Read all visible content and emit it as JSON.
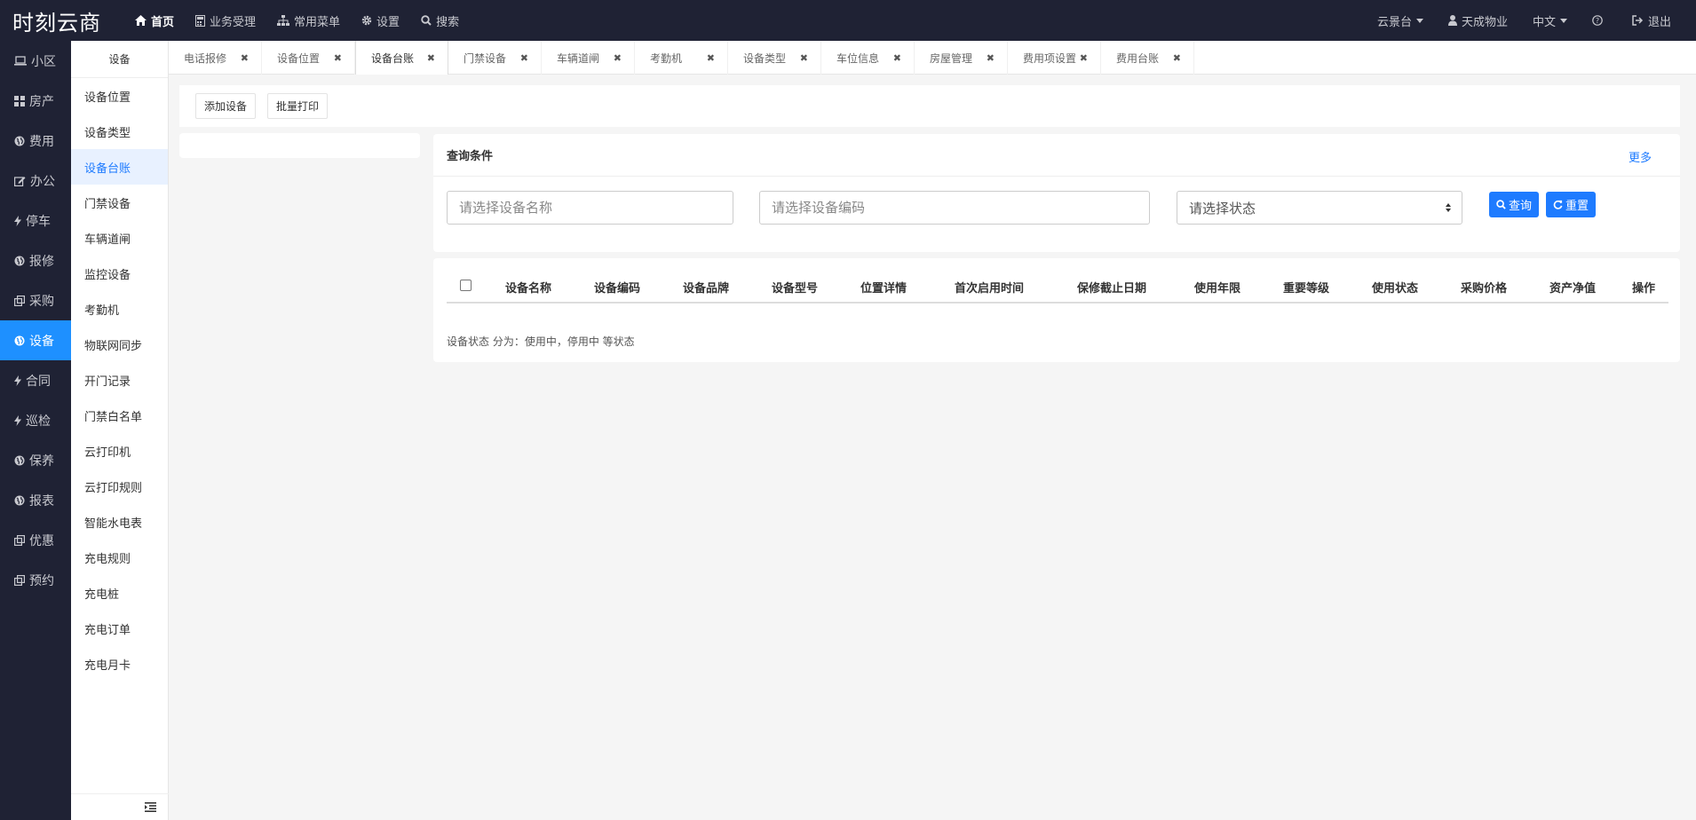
{
  "brand": "时刻云商",
  "topnav": [
    {
      "label": "首页",
      "icon": "home-icon",
      "active": true
    },
    {
      "label": "业务受理",
      "icon": "calculator-icon",
      "active": false
    },
    {
      "label": "常用菜单",
      "icon": "sitemap-icon",
      "active": false
    },
    {
      "label": "设置",
      "icon": "gear-icon",
      "active": false
    },
    {
      "label": "搜索",
      "icon": "search-icon",
      "active": false
    }
  ],
  "topright": {
    "community": "云景台",
    "company": "天成物业",
    "language": "中文",
    "logout": "退出"
  },
  "sidebar": [
    {
      "label": "小区",
      "icon": "laptop-icon"
    },
    {
      "label": "房产",
      "icon": "grid-icon"
    },
    {
      "label": "费用",
      "icon": "globe-icon"
    },
    {
      "label": "办公",
      "icon": "edit-icon"
    },
    {
      "label": "停车",
      "icon": "bolt-icon"
    },
    {
      "label": "报修",
      "icon": "globe-icon"
    },
    {
      "label": "采购",
      "icon": "clone-icon"
    },
    {
      "label": "设备",
      "icon": "globe-icon",
      "active": true
    },
    {
      "label": "合同",
      "icon": "bolt-icon"
    },
    {
      "label": "巡检",
      "icon": "bolt-icon"
    },
    {
      "label": "保养",
      "icon": "globe-icon"
    },
    {
      "label": "报表",
      "icon": "globe-icon"
    },
    {
      "label": "优惠",
      "icon": "clone-icon"
    },
    {
      "label": "预约",
      "icon": "clone-icon"
    }
  ],
  "submenu": {
    "title": "设备",
    "items": [
      {
        "label": "设备位置"
      },
      {
        "label": "设备类型"
      },
      {
        "label": "设备台账",
        "active": true
      },
      {
        "label": "门禁设备"
      },
      {
        "label": "车辆道闸"
      },
      {
        "label": "监控设备"
      },
      {
        "label": "考勤机"
      },
      {
        "label": "物联网同步"
      },
      {
        "label": "开门记录"
      },
      {
        "label": "门禁白名单"
      },
      {
        "label": "云打印机"
      },
      {
        "label": "云打印规则"
      },
      {
        "label": "智能水电表"
      },
      {
        "label": "充电规则"
      },
      {
        "label": "充电桩"
      },
      {
        "label": "充电订单"
      },
      {
        "label": "充电月卡"
      }
    ]
  },
  "tabs": [
    {
      "label": "电话报修"
    },
    {
      "label": "设备位置"
    },
    {
      "label": "设备台账",
      "active": true
    },
    {
      "label": "门禁设备"
    },
    {
      "label": "车辆道闸"
    },
    {
      "label": "考勤机"
    },
    {
      "label": "设备类型"
    },
    {
      "label": "车位信息"
    },
    {
      "label": "房屋管理"
    },
    {
      "label": "费用项设置"
    },
    {
      "label": "费用台账"
    }
  ],
  "tab_close": "✖",
  "toolbar": {
    "add_label": "添加设备",
    "print_label": "批量打印"
  },
  "query": {
    "title": "查询条件",
    "more": "更多",
    "name_placeholder": "请选择设备名称",
    "code_placeholder": "请选择设备编码",
    "status_placeholder": "请选择状态",
    "search_label": "查询",
    "reset_label": "重置"
  },
  "table": {
    "columns": [
      "设备名称",
      "设备编码",
      "设备品牌",
      "设备型号",
      "位置详情",
      "首次启用时间",
      "保修截止日期",
      "使用年限",
      "重要等级",
      "使用状态",
      "采购价格",
      "资产净值",
      "操作"
    ],
    "note": "设备状态 分为：使用中，停用中 等状态"
  },
  "colors": {
    "nav_bg": "#1f2234",
    "accent": "#1e7bff",
    "active_sidebar": "#1e90ff"
  }
}
